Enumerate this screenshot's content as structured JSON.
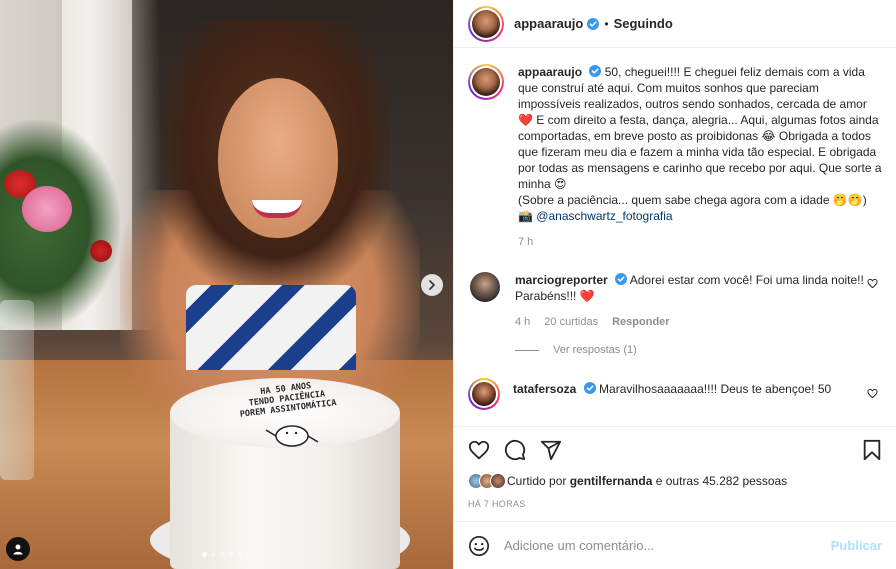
{
  "post": {
    "author": {
      "username": "appaaraujo",
      "verified": true,
      "follow_status": "Seguindo",
      "separator": "•"
    },
    "caption": {
      "username": "appaaraujo",
      "lines": [
        "50, cheguei!!!! E cheguei feliz demais com a vida que construí até aqui. Com muitos sonhos que pareciam impossíveis realizados, outros sendo sonhados, cercada de amor",
        "E com direito a festa, dança, alegria... Aqui, algumas fotos ainda comportadas, em breve posto as proibidonas",
        "Obrigada a todos que fizeram meu dia e fazem a minha vida tão especial. E obrigada por todas as mensagens e carinho que recebo por aqui. Que sorte a minha",
        "(Sobre a paciência... quem sabe chega agora com a idade 🤭🤭)"
      ],
      "emojis": [
        "❤️",
        "😂",
        "😍"
      ],
      "credit_icon": "📸",
      "mention": "@anaschwartz_fotografia",
      "time_ago": "7 h"
    },
    "comments": [
      {
        "username": "marciogreporter",
        "verified": true,
        "text": "Adorei estar com você! Foi uma linda noite!! Parabéns!!!",
        "emoji": "❤️",
        "time_ago": "4 h",
        "likes": "20 curtidas",
        "reply_label": "Responder",
        "view_replies": "Ver respostas (1)"
      },
      {
        "username": "tatafersoza",
        "verified": true,
        "text": "Maravilhosaaaaaaa!!!! Deus te abençoe! 50"
      }
    ],
    "liked_by": {
      "prefix": "Curtido por",
      "user": "gentilfernanda",
      "suffix": "e outras 45.282 pessoas"
    },
    "timestamp": "HÁ 7 HORAS",
    "add_comment": {
      "placeholder": "Adicione um comentário...",
      "post_label": "Publicar"
    },
    "cake_text": [
      "HA 50 ANOS",
      "TENDO PACIÊNCIA",
      "POREM ASSINTOMÁTICA"
    ]
  },
  "icons": {
    "verified": "verified-badge-icon",
    "heart": "heart-icon",
    "comment": "comment-icon",
    "share": "share-icon",
    "save": "bookmark-icon",
    "emoji": "emoji-icon",
    "next": "chevron-right-icon",
    "tags": "user-tag-icon"
  },
  "colors": {
    "verified": "#3897f0",
    "link": "#00376b",
    "heart_red": "#ed4956",
    "post_disabled": "#b2dffc"
  }
}
